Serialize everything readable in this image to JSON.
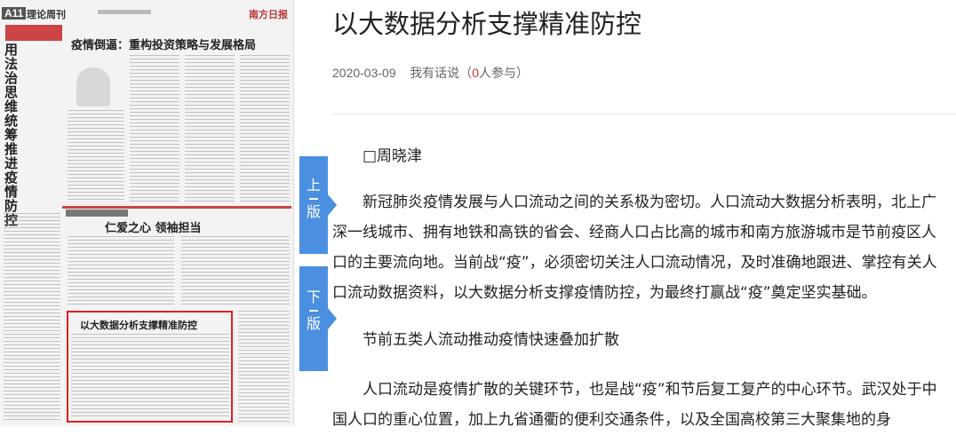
{
  "newspaper": {
    "page_no": "A11",
    "section": "理论周刊",
    "masthead_logo": "南方日报",
    "vertical_title": "用法治思维统筹推进疫情防控",
    "headline_1": "疫情倒逼：重构投资策略与发展格局",
    "headline_2": "仁爱之心 领袖担当",
    "headline_3": "以大数据分析支撑精准防控"
  },
  "nav": {
    "prev_page": [
      "上",
      "版"
    ],
    "next_page": [
      "下",
      "版"
    ]
  },
  "article": {
    "title": "以大数据分析支撑精准防控",
    "date": "2020-03-09",
    "comment_prefix": "我有话说（",
    "comment_count": "0",
    "comment_suffix": "人参与）",
    "paragraphs": [
      "□周晓津",
      "新冠肺炎疫情发展与人口流动之间的关系极为密切。人口流动大数据分析表明，北上广深一线城市、拥有地铁和高铁的省会、经商人口占比高的城市和南方旅游城市是节前疫区人口的主要流向地。当前战“疫”，必须密切关注人口流动情况，及时准确地跟进、掌控有关人口流动数据资料，以大数据分析支撑疫情防控，为最终打赢战“疫”奠定坚实基础。",
      "节前五类人流动推动疫情快速叠加扩散",
      "人口流动是疫情扩散的关键环节，也是战“疫”和节后复工复产的中心环节。武汉处于中国人口的重心位置，加上九省通衢的便利交通条件，以及全国高校第三大聚集地的身"
    ]
  }
}
